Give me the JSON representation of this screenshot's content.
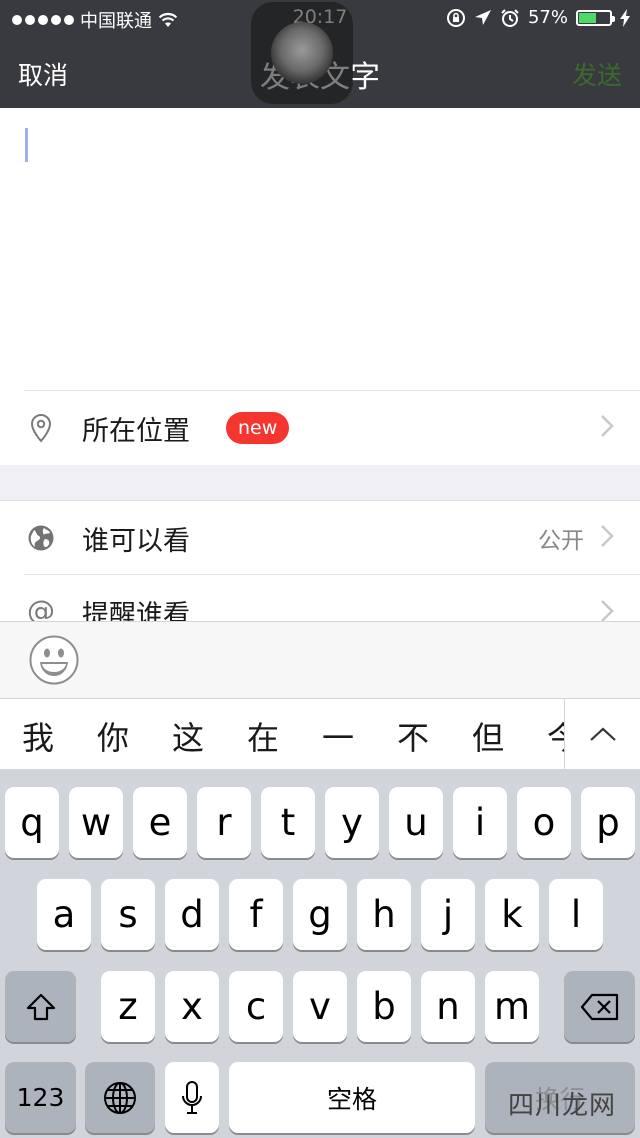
{
  "status_bar": {
    "carrier": "中国联通",
    "time": "20:17",
    "battery_percent": "57%",
    "battery_level": 0.57,
    "battery_color": "#4cd964"
  },
  "nav": {
    "cancel_label": "取消",
    "title": "发表文字",
    "send_label": "发送",
    "send_color": "#3a6b2d"
  },
  "compose": {
    "text": ""
  },
  "options": {
    "location": {
      "label": "所在位置",
      "badge": "new",
      "icon": "location-pin-icon"
    },
    "visibility": {
      "label": "谁可以看",
      "value": "公开",
      "icon": "globe-icon"
    },
    "remind": {
      "label": "提醒谁看",
      "icon": "at-icon"
    }
  },
  "emoji_bar": {
    "icon": "smiley-icon"
  },
  "candidates": [
    "我",
    "你",
    "这",
    "在",
    "一",
    "不",
    "但",
    "今"
  ],
  "keyboard": {
    "row1": [
      "q",
      "w",
      "e",
      "r",
      "t",
      "y",
      "u",
      "i",
      "o",
      "p"
    ],
    "row2": [
      "a",
      "s",
      "d",
      "f",
      "g",
      "h",
      "j",
      "k",
      "l"
    ],
    "row3": [
      "z",
      "x",
      "c",
      "v",
      "b",
      "n",
      "m"
    ],
    "numbers_label": "123",
    "space_label": "空格",
    "return_label": "换行"
  },
  "watermark": "四川龙网"
}
